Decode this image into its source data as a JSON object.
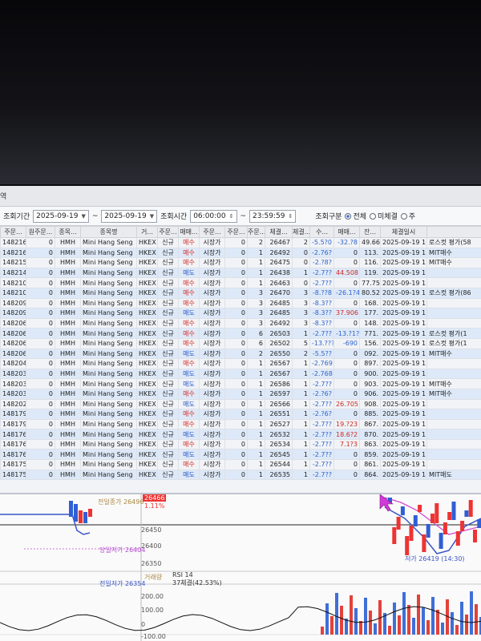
{
  "window": {
    "title_fragment": "역"
  },
  "filters": {
    "period_label": "조회기간",
    "date_from": "2025-09-19",
    "tilde": "~",
    "date_to": "2025-09-19",
    "time_label": "조회시간",
    "time_from": "06:00:00",
    "time_to": "23:59:59",
    "mode_label": "조회구분",
    "radio_all": "전체",
    "radio_fill": "미체결",
    "radio_3": "주"
  },
  "table": {
    "headers": [
      "주문...",
      "원주문...",
      "종목...",
      "종목명",
      "거...",
      "주문...",
      "매매...",
      "주문...",
      "주문...",
      "주문...",
      "체결...",
      "체결...",
      "수...",
      "매매...",
      "잔...",
      "체결일시",
      ""
    ],
    "rows": [
      [
        "1482167",
        "0",
        "HMH",
        "Mini Hang Seng",
        "HKEX",
        "신규",
        "매수",
        "시장가",
        "0",
        "2",
        "26467",
        "2",
        "-5.5?0",
        "-32.?8",
        "49.664",
        "2025-09-19 1",
        "로스컷 평가(58"
      ],
      [
        "1482161",
        "0",
        "HMH",
        "Mini Hang Seng",
        "HKEX",
        "신규",
        "매수",
        "시장가",
        "0",
        "1",
        "26492",
        "0",
        "-2.76?",
        "0",
        "113.",
        "2025-09-19 1",
        "MIT매수"
      ],
      [
        "1482153",
        "0",
        "HMH",
        "Mini Hang Seng",
        "HKEX",
        "신규",
        "매수",
        "시장가",
        "0",
        "1",
        "26475",
        "0",
        "-2.?8?",
        "0",
        "116.",
        "2025-09-19 1",
        "MIT매수"
      ],
      [
        "1482140",
        "0",
        "HMH",
        "Mini Hang Seng",
        "HKEX",
        "신규",
        "매도",
        "시장가",
        "0",
        "1",
        "26438",
        "1",
        "-2.7??",
        "44.508",
        "119.",
        "2025-09-19 1",
        ""
      ],
      [
        "1482109",
        "0",
        "HMH",
        "Mini Hang Seng",
        "HKEX",
        "신규",
        "매수",
        "시장가",
        "0",
        "1",
        "26463",
        "0",
        "-2.7??",
        "0",
        "77.753",
        "2025-09-19 1",
        ""
      ],
      [
        "1482103",
        "0",
        "HMH",
        "Mini Hang Seng",
        "HKEX",
        "신규",
        "매수",
        "시장가",
        "0",
        "3",
        "26470",
        "3",
        "-8.??8",
        "-26.1?4",
        "80.522",
        "2025-09-19 1",
        "로스컷 평가(86"
      ],
      [
        "1482097",
        "0",
        "HMH",
        "Mini Hang Seng",
        "HKEX",
        "신규",
        "매수",
        "시장가",
        "0",
        "3",
        "26485",
        "3",
        "-8.3??",
        "0",
        "168.",
        "2025-09-19 1",
        ""
      ],
      [
        "1482096",
        "0",
        "HMH",
        "Mini Hang Seng",
        "HKEX",
        "신규",
        "매도",
        "시장가",
        "0",
        "3",
        "26485",
        "3",
        "-8.3??",
        "37.906",
        "177.",
        "2025-09-19 1",
        ""
      ],
      [
        "1482063",
        "0",
        "HMH",
        "Mini Hang Seng",
        "HKEX",
        "신규",
        "매수",
        "시장가",
        "0",
        "3",
        "26492",
        "3",
        "-8.3??",
        "0",
        "148.",
        "2025-09-19 1",
        ""
      ],
      [
        "1482060",
        "0",
        "HMH",
        "Mini Hang Seng",
        "HKEX",
        "신규",
        "매수",
        "시장가",
        "0",
        "6",
        "26503",
        "1",
        "-2.7??",
        "-13.?1?",
        "771.",
        "2025-09-19 1",
        "로스컷 평가(1"
      ],
      [
        "1482060",
        "0",
        "HMH",
        "Mini Hang Seng",
        "HKEX",
        "신규",
        "매수",
        "시장가",
        "0",
        "6",
        "26502",
        "5",
        "-13.???",
        "-690",
        "156.",
        "2025-09-19 1",
        "로스컷 평가(1"
      ],
      [
        "1482060",
        "0",
        "HMH",
        "Mini Hang Seng",
        "HKEX",
        "신규",
        "매도",
        "시장가",
        "0",
        "2",
        "26550",
        "2",
        "-5.5??",
        "0",
        "092.",
        "2025-09-19 1",
        "MIT매수"
      ],
      [
        "1482048",
        "0",
        "HMH",
        "Mini Hang Seng",
        "HKEX",
        "신규",
        "매수",
        "시장가",
        "0",
        "1",
        "26567",
        "1",
        "-2.769",
        "0",
        "897.",
        "2025-09-19 1",
        ""
      ],
      [
        "1482036",
        "0",
        "HMH",
        "Mini Hang Seng",
        "HKEX",
        "신규",
        "매도",
        "시장가",
        "0",
        "1",
        "26567",
        "1",
        "-2.768",
        "0",
        "900.",
        "2025-09-19 1",
        ""
      ],
      [
        "1482035",
        "0",
        "HMH",
        "Mini Hang Seng",
        "HKEX",
        "신규",
        "매도",
        "시장가",
        "0",
        "1",
        "26586",
        "1",
        "-2.7??",
        "0",
        "903.",
        "2025-09-19 1",
        "MIT매수"
      ],
      [
        "1482031",
        "0",
        "HMH",
        "Mini Hang Seng",
        "HKEX",
        "신규",
        "매수",
        "시장가",
        "0",
        "1",
        "26597",
        "1",
        "-2.?6?",
        "0",
        "906.",
        "2025-09-19 1",
        "MIT매수"
      ],
      [
        "1482029",
        "0",
        "HMH",
        "Mini Hang Seng",
        "HKEX",
        "신규",
        "매도",
        "시장가",
        "0",
        "1",
        "26566",
        "1",
        "-2.7??",
        "26.705",
        "908.",
        "2025-09-19 1",
        ""
      ],
      [
        "1481797",
        "0",
        "HMH",
        "Mini Hang Seng",
        "HKEX",
        "신규",
        "매수",
        "시장가",
        "0",
        "1",
        "26551",
        "1",
        "-2.?6?",
        "0",
        "885.",
        "2025-09-19 1",
        ""
      ],
      [
        "1481795",
        "0",
        "HMH",
        "Mini Hang Seng",
        "HKEX",
        "신규",
        "매수",
        "시장가",
        "0",
        "1",
        "26527",
        "1",
        "-2.7??",
        "19.?23",
        "867.",
        "2025-09-19 1",
        ""
      ],
      [
        "1481768",
        "0",
        "HMH",
        "Mini Hang Seng",
        "HKEX",
        "신규",
        "매도",
        "시장가",
        "0",
        "1",
        "26532",
        "1",
        "-2.7??",
        "18.6?2",
        "870.",
        "2025-09-19 1",
        ""
      ],
      [
        "1481764",
        "0",
        "HMH",
        "Mini Hang Seng",
        "HKEX",
        "신규",
        "매수",
        "시장가",
        "0",
        "1",
        "26534",
        "1",
        "-2.7??",
        "7.1?3",
        "863.",
        "2025-09-19 1",
        ""
      ],
      [
        "1481763",
        "0",
        "HMH",
        "Mini Hang Seng",
        "HKEX",
        "신규",
        "매도",
        "시장가",
        "0",
        "1",
        "26545",
        "1",
        "-2.7??",
        "0",
        "859.",
        "2025-09-19 1",
        ""
      ],
      [
        "1481754",
        "0",
        "HMH",
        "Mini Hang Seng",
        "HKEX",
        "신규",
        "매수",
        "시장가",
        "0",
        "1",
        "26544",
        "1",
        "-2.7??",
        "0",
        "861.",
        "2025-09-19 1",
        ""
      ],
      [
        "1481753",
        "0",
        "HMH",
        "Mini Hang Seng",
        "HKEX",
        "신규",
        "매도",
        "시장가",
        "0",
        "1",
        "26535",
        "1",
        "-2.7??",
        "0",
        "864.",
        "2025-09-19 1",
        "MIT매도"
      ]
    ]
  },
  "chart": {
    "price_tag": "26466",
    "price_change": "1.11%",
    "label_prev_close": "전일종가 26496",
    "label_day_low": "당일저가 26404",
    "label_day_low2": "전일저가 26354",
    "label_low_marker": "저가 26419 (14:30)",
    "label_rsi": "RSI 14",
    "label_rsi_value": "37체결(42.53%)",
    "label_volume_prefix": "거래량",
    "y_top": "26450",
    "y_mid": "26400",
    "y_low": "26350",
    "vol_200": "200.00",
    "vol_100": "100.00",
    "vol_m100": "-100.00",
    "vol_0": "0"
  }
}
